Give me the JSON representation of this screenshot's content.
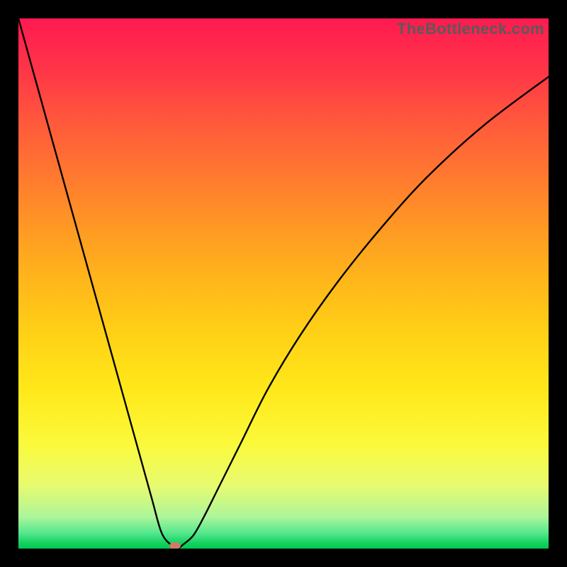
{
  "watermark": "TheBottleneck.com",
  "chart_data": {
    "type": "line",
    "title": "",
    "xlabel": "",
    "ylabel": "",
    "xlim": [
      0,
      100
    ],
    "ylim": [
      0,
      100
    ],
    "grid": false,
    "legend": false,
    "background_gradient": {
      "top": "#ff1a51",
      "bottom": "#00c94f",
      "description": "Vertical gradient red (high bottleneck) to green (no bottleneck)"
    },
    "series": [
      {
        "name": "bottleneck-curve",
        "x": [
          0,
          5,
          10,
          15,
          20,
          25,
          27,
          29,
          30,
          31,
          33,
          35,
          38,
          42,
          47,
          53,
          60,
          68,
          77,
          88,
          100
        ],
        "values": [
          100,
          82,
          64,
          46,
          28,
          10,
          3,
          0.5,
          0,
          0.7,
          2.5,
          6,
          12,
          20,
          30,
          40,
          50,
          60,
          70,
          80,
          89
        ],
        "color": "#000000",
        "stroke_width": 2
      }
    ],
    "marker": {
      "x": 29.5,
      "y": 0.5,
      "color": "#d07a6a",
      "shape": "ellipse"
    }
  }
}
